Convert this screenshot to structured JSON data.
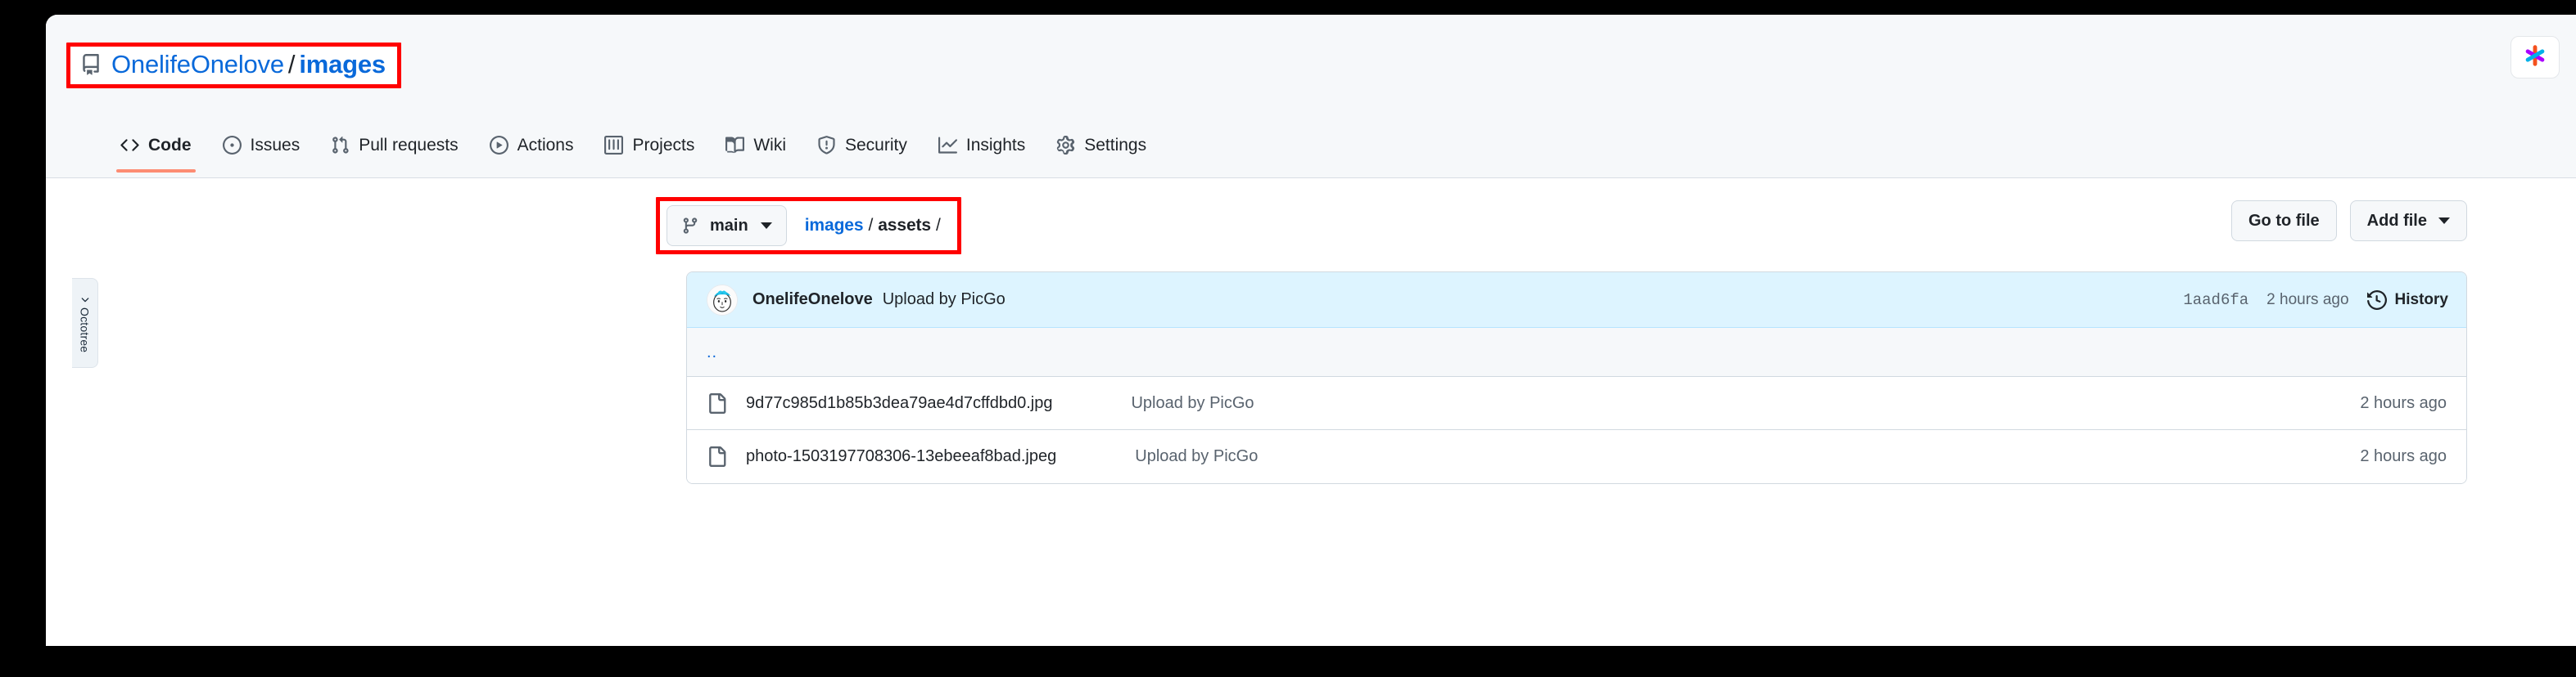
{
  "repo": {
    "icon": "repo-icon",
    "owner": "OnelifeOnelove",
    "separator": "/",
    "name": "images"
  },
  "extension": {
    "icon": "asterisk-extension-icon"
  },
  "nav": {
    "items": [
      {
        "label": "Code",
        "icon": "code-icon",
        "active": true
      },
      {
        "label": "Issues",
        "icon": "issue-opened-icon",
        "active": false
      },
      {
        "label": "Pull requests",
        "icon": "git-pull-request-icon",
        "active": false
      },
      {
        "label": "Actions",
        "icon": "play-icon",
        "active": false
      },
      {
        "label": "Projects",
        "icon": "table-icon",
        "active": false
      },
      {
        "label": "Wiki",
        "icon": "book-icon",
        "active": false
      },
      {
        "label": "Security",
        "icon": "shield-icon",
        "active": false
      },
      {
        "label": "Insights",
        "icon": "graph-icon",
        "active": false
      },
      {
        "label": "Settings",
        "icon": "gear-icon",
        "active": false
      }
    ]
  },
  "toolbar": {
    "branch": {
      "name": "main",
      "icon": "git-branch-icon",
      "caret": "chevron-down-icon"
    },
    "breadcrumb": {
      "root": "images",
      "sep1": "/",
      "current": "assets",
      "sep2": "/"
    },
    "go_to_file_label": "Go to file",
    "add_file_label": "Add file"
  },
  "commit": {
    "author": "OnelifeOnelove",
    "message": "Upload by PicGo",
    "sha": "1aad6fa",
    "time": "2 hours ago",
    "history_label": "History",
    "history_icon": "history-clock-icon",
    "avatar": "user-avatar"
  },
  "files": {
    "parent_label": "..",
    "rows": [
      {
        "icon": "file-icon",
        "name": "9d77c985d1b85b3dea79ae4d7cffdbd0.jpg",
        "commit": "Upload by PicGo",
        "time": "2 hours ago"
      },
      {
        "icon": "file-icon",
        "name": "photo-1503197708306-13ebeeaf8bad.jpeg",
        "commit": "Upload by PicGo",
        "time": "2 hours ago"
      }
    ]
  },
  "octotree": {
    "label": "Octotree",
    "icon": "chevron-right-icon"
  },
  "colors": {
    "link": "#0969da",
    "active_tab_underline": "#fd8c73",
    "annotation_box": "#ff0000",
    "commit_row_bg": "#ddf4ff",
    "header_bg": "#f6f8fa",
    "border": "#d1d9e0"
  }
}
